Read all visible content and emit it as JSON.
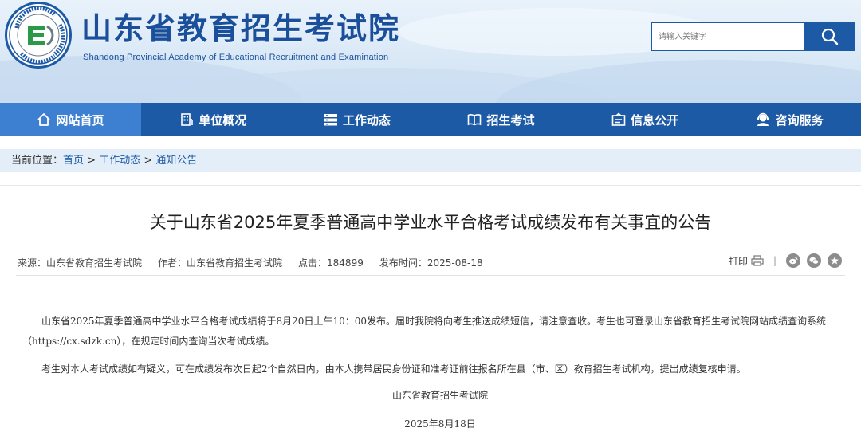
{
  "header": {
    "title": "山东省教育招生考试院",
    "subtitle": "Shandong Provincial Academy of Educational Recruitment and Examination",
    "logo_ring_text": "Shandong Educational Admission & Examination",
    "logo_bottom_text": "山东省教育招生考试院"
  },
  "search": {
    "placeholder": "请输入关键字"
  },
  "nav": {
    "items": [
      {
        "label": "网站首页",
        "icon": "home-icon"
      },
      {
        "label": "单位概况",
        "icon": "building-icon"
      },
      {
        "label": "工作动态",
        "icon": "list-icon"
      },
      {
        "label": "招生考试",
        "icon": "book-icon"
      },
      {
        "label": "信息公开",
        "icon": "info-panel-icon"
      },
      {
        "label": "咨询服务",
        "icon": "service-icon"
      }
    ]
  },
  "breadcrumb": {
    "prefix": "当前位置：",
    "home": "首页",
    "sep": " > ",
    "level1": "工作动态",
    "level2": "通知公告"
  },
  "article": {
    "title": "关于山东省2025年夏季普通高中学业水平合格考试成绩发布有关事宜的公告",
    "source": "来源：山东省教育招生考试院",
    "author": "作者：山东省教育招生考试院",
    "clicks": "点击：184899",
    "published": "发布时间：2025-08-18",
    "print_label": "打印",
    "para1": "山东省2025年夏季普通高中学业水平合格考试成绩将于8月20日上午10：00发布。届时我院将向考生推送成绩短信，请注意查收。考生也可登录山东省教育招生考试院网站成绩查询系统（https://cx.sdzk.cn），在规定时间内查询当次考试成绩。",
    "para2": "考生对本人考试成绩如有疑义，可在成绩发布次日起2个自然日内，由本人携带居民身份证和准考证前往报名所在县（市、区）教育招生考试机构，提出成绩复核申请。",
    "signature": "山东省教育招生考试院",
    "date": "2025年8月18日"
  },
  "colors": {
    "brand_blue": "#1d5aa6",
    "nav_active": "#3d7fd1",
    "crumb_bg": "#e3eef8"
  }
}
